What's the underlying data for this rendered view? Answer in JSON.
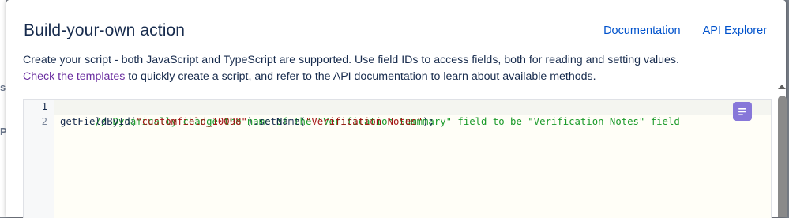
{
  "modal": {
    "title": "Build-your-own action",
    "links": {
      "documentation": "Documentation",
      "api_explorer": "API Explorer"
    },
    "description": {
      "line1": "Create your script - both JavaScript and TypeScript are supported. Use field IDs to access fields, both for reading and setting values.",
      "link_text": "Check the templates",
      "line2_rest": " to quickly create a script, and refer to the API documentation to learn about available methods."
    }
  },
  "editor": {
    "lines": [
      {
        "number": "1",
        "comment": "// Dynamically change the name of the \"Verification Summmary\" field to be \"Verification Notes\" field"
      },
      {
        "number": "2",
        "part1": "getFieldById(",
        "string1": "\"customfield_10098\"",
        "part2": ").setName(",
        "string2": "\"Verification Notes\"",
        "part3": ");"
      }
    ],
    "format_button_icon": "format-lines-icon"
  },
  "background": {
    "glyph_s": "s",
    "glyph_p": "P"
  },
  "colors": {
    "title": "#172b4d",
    "link": "#0052cc",
    "visited_link": "#6b2fa0",
    "comment": "#1a9a2a",
    "string": "#a31515",
    "format_button": "#8777d9"
  }
}
